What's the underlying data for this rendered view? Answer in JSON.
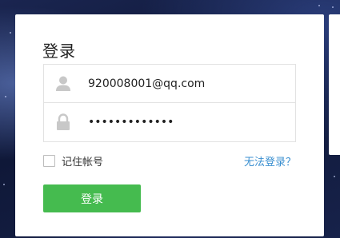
{
  "login": {
    "title": "登录",
    "username_value": "920008001@qq.com",
    "password_mask": "•••••••••••••",
    "remember_label": "记住帐号",
    "remember_checked": false,
    "forgot_link": "无法登录？",
    "submit_label": "登录"
  },
  "icons": {
    "username": "user-icon",
    "password": "lock-icon"
  },
  "colors": {
    "primary_button": "#45bb4f",
    "link": "#3a8fd0",
    "icon_gray": "#c8c8c8"
  }
}
